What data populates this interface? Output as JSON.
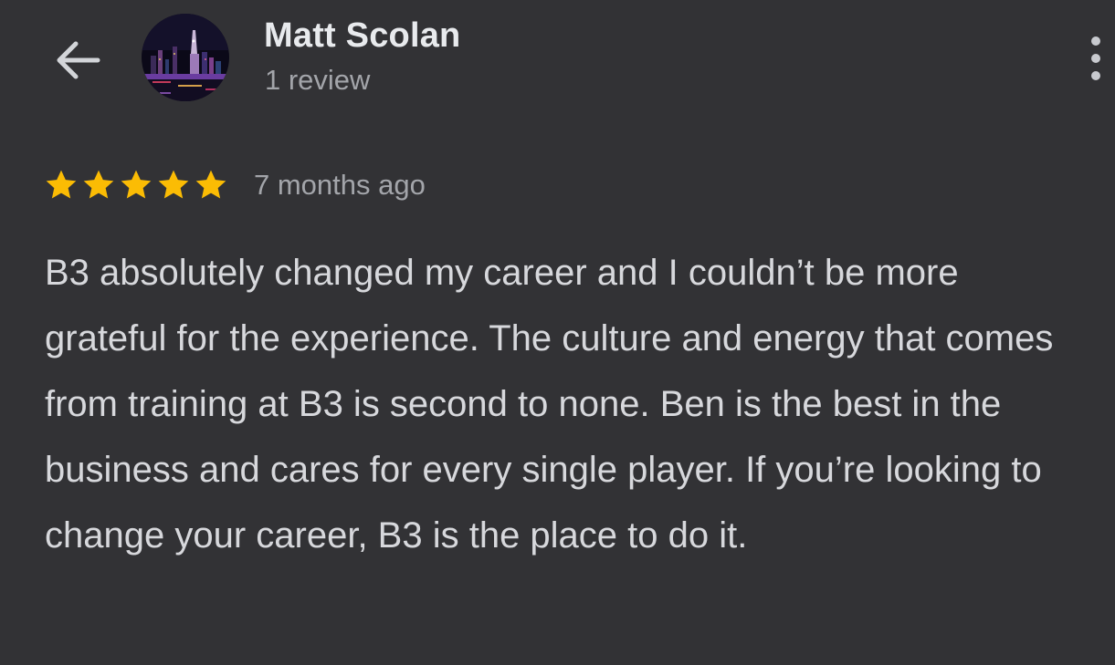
{
  "header": {
    "back_icon": "arrow-left-icon",
    "avatar_icon": "city-night-photo",
    "reviewer_name": "Matt Scolan",
    "review_count": "1 review",
    "more_icon": "more-vertical-icon"
  },
  "review": {
    "rating": 5,
    "max_rating": 5,
    "star_icon": "star-icon",
    "date": "7 months ago",
    "text": "B3 absolutely changed my career and I couldn’t be more grateful for the experience. The culture and energy that comes from training at B3 is second to none. Ben is the best in the business and cares for every single player. If you’re looking to change your career, B3 is the place to do it."
  },
  "colors": {
    "background": "#323235",
    "name_text": "#e8eaed",
    "secondary_text": "#a3a5aa",
    "body_text": "#d7d8dc",
    "star": "#fbbc04"
  }
}
